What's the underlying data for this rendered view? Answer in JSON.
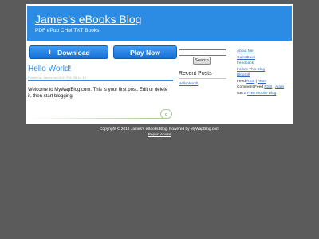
{
  "header": {
    "title": "James's eBooks Blog",
    "description": "PDF ePub CHM TXT Books"
  },
  "buttons": {
    "download": "Download",
    "play": "Play Now"
  },
  "post": {
    "title": "Hello World!",
    "meta": "Posted by James on 08:01 PM, 05 Jul 16",
    "body": "Welcome to MyWapBlog.com. This is your first post. Edit or delete it, then start blogging!",
    "comments": "0"
  },
  "search": {
    "button": "Search"
  },
  "recent_posts": {
    "title": "Recent Posts",
    "items": [
      "Hello World!"
    ]
  },
  "links": {
    "about": "About Me",
    "guestbook": "Guestbook",
    "feedback": "Feedback",
    "follow": "Follow This Blog",
    "blogroll": "Blogroll",
    "feed_label": "Feed",
    "feed_rss": "RSS",
    "feed_sep": "|",
    "feed_atom": "Atom",
    "comment_feed_label": "Comment Feed",
    "comment_rss": "RSS",
    "comment_sep": "|",
    "comment_atom": "Atom",
    "get_label": "Get a",
    "get_link": "Free Mobile Blog"
  },
  "footer": {
    "copyright_prefix": "Copyright © 2016",
    "blog_link": "James's eBooks Blog",
    "powered_by": ". Powered by",
    "mwb_link": "MyWapBlog.com",
    "report_link": "Report Abuse"
  },
  "colors": {
    "header_bg": "#2c8ce4",
    "page_bg": "#5b5b5b",
    "link": "#2c6cc4"
  }
}
